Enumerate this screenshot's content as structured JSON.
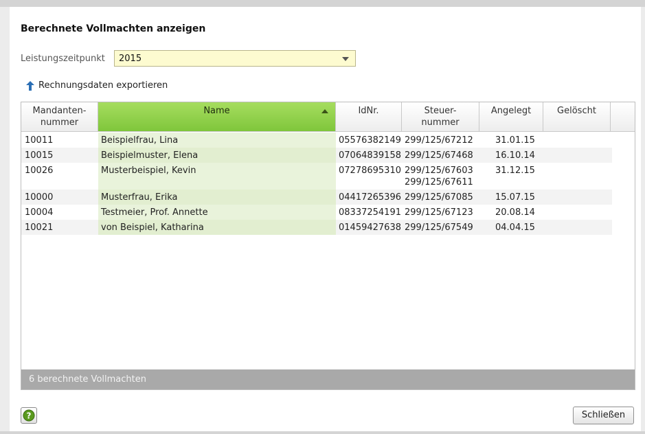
{
  "dialog": {
    "title": "Berechnete Vollmachten anzeigen",
    "period_label": "Leistungszeitpunkt",
    "period_value": "2015",
    "export_label": "Rechnungsdaten exportieren",
    "footer_text": "6 berechnete Vollmachten",
    "close_label": "Schließen"
  },
  "table": {
    "headers": {
      "mandant": [
        "Mandanten-",
        "nummer"
      ],
      "name": "Name",
      "idnr": "IdNr.",
      "steuer": [
        "Steuer-",
        "nummer"
      ],
      "angelegt": "Angelegt",
      "geloescht": "Gelöscht"
    },
    "rows": [
      {
        "mandant": "10011",
        "name": "Beispielfrau, Lina",
        "idnr": "05576382149",
        "steuer": [
          "299/125/67212"
        ],
        "angelegt": "31.01.15",
        "geloescht": ""
      },
      {
        "mandant": "10015",
        "name": "Beispielmuster, Elena",
        "idnr": "07064839158",
        "steuer": [
          "299/125/67468"
        ],
        "angelegt": "16.10.14",
        "geloescht": ""
      },
      {
        "mandant": "10026",
        "name": "Musterbeispiel, Kevin",
        "idnr": "07278695310",
        "steuer": [
          "299/125/67603",
          "299/125/67611"
        ],
        "angelegt": "31.12.15",
        "geloescht": ""
      },
      {
        "mandant": "10000",
        "name": "Musterfrau, Erika",
        "idnr": "04417265396",
        "steuer": [
          "299/125/67085"
        ],
        "angelegt": "15.07.15",
        "geloescht": ""
      },
      {
        "mandant": "10004",
        "name": "Testmeier, Prof. Annette",
        "idnr": "08337254191",
        "steuer": [
          "299/125/67123"
        ],
        "angelegt": "20.08.14",
        "geloescht": ""
      },
      {
        "mandant": "10021",
        "name": "von Beispiel, Katharina",
        "idnr": "01459427638",
        "steuer": [
          "299/125/67549"
        ],
        "angelegt": "04.04.15",
        "geloescht": ""
      }
    ]
  },
  "colors": {
    "sorted_header": "#8ccf45",
    "name_column": "#e9f3db",
    "select_background": "#fdfbd0",
    "footer_bar": "#a9a9a9",
    "export_icon": "#2b6fb5",
    "help_icon": "#5a9a1e"
  },
  "icons": {
    "export": "arrow-up-icon",
    "sort": "sort-ascending-icon",
    "dropdown": "chevron-down-icon",
    "help": "help-icon"
  }
}
